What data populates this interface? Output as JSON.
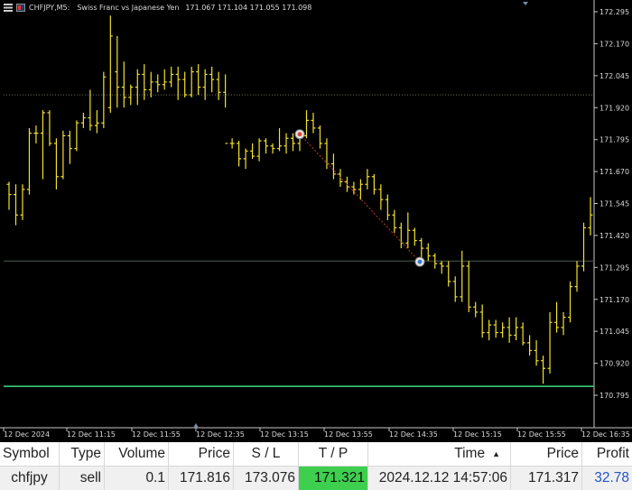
{
  "chart_header": {
    "symbol_tf": "CHFJPY,M5:",
    "description": "Swiss Franc vs Japanese Yen",
    "ohlc": "171.067 171.104 171.055 171.098"
  },
  "colors": {
    "background": "#000000",
    "bar": "#f2e22a",
    "grid_level": "#2e3a2e",
    "tp_line": "#3ddc84",
    "trade_line": "#c0392b",
    "profit_text": "#2255c8",
    "tp_cell": "#3ecf4f"
  },
  "chart_data": {
    "type": "ohlc_bar",
    "symbol": "CHFJPY",
    "timeframe": "M5",
    "y_ticks": [
      "172.295",
      "172.170",
      "172.045",
      "171.920",
      "171.795",
      "171.670",
      "171.545",
      "171.420",
      "171.295",
      "171.170",
      "171.045",
      "170.920",
      "170.795"
    ],
    "ylim": [
      170.72,
      172.33
    ],
    "x_ticks": [
      "12 Dec 2024",
      "12 Dec 11:15",
      "12 Dec 11:55",
      "12 Dec 12:35",
      "12 Dec 13:15",
      "12 Dec 13:55",
      "12 Dec 14:35",
      "12 Dec 15:15",
      "12 Dec 15:55",
      "12 Dec 16:35"
    ],
    "levels": {
      "stop_loss": 173.076,
      "take_profit": 171.321,
      "entry": 171.816,
      "close": 171.317,
      "dotted_level": 171.97,
      "current": 171.32,
      "tp_visual": 170.83
    },
    "bars": [
      [
        171.62,
        171.63,
        171.52,
        171.58
      ],
      [
        171.58,
        171.62,
        171.46,
        171.5
      ],
      [
        171.5,
        171.62,
        171.48,
        171.6
      ],
      [
        171.6,
        171.84,
        171.58,
        171.82
      ],
      [
        171.82,
        171.85,
        171.78,
        171.82
      ],
      [
        171.82,
        171.91,
        171.64,
        171.9
      ],
      [
        171.9,
        171.91,
        171.77,
        171.78
      ],
      [
        171.78,
        171.8,
        171.6,
        171.65
      ],
      [
        171.65,
        171.83,
        171.64,
        171.81
      ],
      [
        171.81,
        171.83,
        171.7,
        171.76
      ],
      [
        171.76,
        171.87,
        171.75,
        171.86
      ],
      [
        171.86,
        171.9,
        171.84,
        171.88
      ],
      [
        171.88,
        171.99,
        171.83,
        171.85
      ],
      [
        171.85,
        171.91,
        171.82,
        171.86
      ],
      [
        171.86,
        172.06,
        171.84,
        172.04
      ],
      [
        171.92,
        172.28,
        171.9,
        172.2
      ],
      [
        172.06,
        172.2,
        171.92,
        172.0
      ],
      [
        172.0,
        172.1,
        171.92,
        171.96
      ],
      [
        171.96,
        172.01,
        171.93,
        172.0
      ],
      [
        172.0,
        172.07,
        171.93,
        172.05
      ],
      [
        172.05,
        172.09,
        171.95,
        171.99
      ],
      [
        171.99,
        172.06,
        171.96,
        172.02
      ],
      [
        172.02,
        172.05,
        171.98,
        172.01
      ],
      [
        172.01,
        172.07,
        171.99,
        172.02
      ],
      [
        172.02,
        172.08,
        172.0,
        172.05
      ],
      [
        172.05,
        172.08,
        171.95,
        172.03
      ],
      [
        172.03,
        172.06,
        171.96,
        171.97
      ],
      [
        171.97,
        172.08,
        171.96,
        172.06
      ],
      [
        172.06,
        172.09,
        171.97,
        172.0
      ],
      [
        172.0,
        172.07,
        171.95,
        172.05
      ],
      [
        172.05,
        172.08,
        171.98,
        172.03
      ],
      [
        172.03,
        172.06,
        171.95,
        171.98
      ],
      [
        171.98,
        172.05,
        171.92,
        171.78
      ],
      [
        171.78,
        171.8,
        171.76,
        171.78
      ],
      [
        171.78,
        171.79,
        171.69,
        171.72
      ],
      [
        171.72,
        171.76,
        171.68,
        171.75
      ],
      [
        171.75,
        171.78,
        171.72,
        171.73
      ],
      [
        171.73,
        171.8,
        171.71,
        171.79
      ],
      [
        171.79,
        171.8,
        171.74,
        171.77
      ],
      [
        171.77,
        171.78,
        171.74,
        171.76
      ],
      [
        171.76,
        171.84,
        171.75,
        171.77
      ],
      [
        171.77,
        171.82,
        171.74,
        171.8
      ],
      [
        171.8,
        171.82,
        171.75,
        171.78
      ],
      [
        171.78,
        171.82,
        171.75,
        171.81
      ],
      [
        171.81,
        171.91,
        171.8,
        171.87
      ],
      [
        171.87,
        171.9,
        171.82,
        171.84
      ],
      [
        171.84,
        171.85,
        171.76,
        171.78
      ],
      [
        171.78,
        171.8,
        171.68,
        171.7
      ],
      [
        171.7,
        171.74,
        171.64,
        171.66
      ],
      [
        171.66,
        171.68,
        171.61,
        171.63
      ],
      [
        171.63,
        171.65,
        171.59,
        171.61
      ],
      [
        171.61,
        171.63,
        171.58,
        171.6
      ],
      [
        171.6,
        171.64,
        171.56,
        171.62
      ],
      [
        171.62,
        171.68,
        171.6,
        171.65
      ],
      [
        171.65,
        171.66,
        171.58,
        171.6
      ],
      [
        171.6,
        171.62,
        171.52,
        171.56
      ],
      [
        171.56,
        171.58,
        171.48,
        171.5
      ],
      [
        171.5,
        171.52,
        171.43,
        171.45
      ],
      [
        171.45,
        171.47,
        171.37,
        171.39
      ],
      [
        171.39,
        171.51,
        171.37,
        171.44
      ],
      [
        171.44,
        171.45,
        171.38,
        171.4
      ],
      [
        171.4,
        171.41,
        171.33,
        171.37
      ],
      [
        171.37,
        171.39,
        171.32,
        171.34
      ],
      [
        171.34,
        171.35,
        171.29,
        171.31
      ],
      [
        171.31,
        171.32,
        171.27,
        171.3
      ],
      [
        171.3,
        171.32,
        171.22,
        171.24
      ],
      [
        171.24,
        171.26,
        171.16,
        171.18
      ],
      [
        171.18,
        171.36,
        171.16,
        171.3
      ],
      [
        171.3,
        171.32,
        171.12,
        171.14
      ],
      [
        171.14,
        171.16,
        171.1,
        171.12
      ],
      [
        171.12,
        171.15,
        171.02,
        171.04
      ],
      [
        171.04,
        171.09,
        171.01,
        171.07
      ],
      [
        171.07,
        171.09,
        171.02,
        171.04
      ],
      [
        171.04,
        171.08,
        171.02,
        171.06
      ],
      [
        171.06,
        171.1,
        171.0,
        171.03
      ],
      [
        171.03,
        171.1,
        171.01,
        171.06
      ],
      [
        171.06,
        171.08,
        170.99,
        171.0
      ],
      [
        171.0,
        171.03,
        170.95,
        170.97
      ],
      [
        170.97,
        171.01,
        170.91,
        170.93
      ],
      [
        170.93,
        170.95,
        170.84,
        170.9
      ],
      [
        170.9,
        171.12,
        170.88,
        171.08
      ],
      [
        171.08,
        171.16,
        171.04,
        171.06
      ],
      [
        171.06,
        171.12,
        171.03,
        171.1
      ],
      [
        171.1,
        171.24,
        171.08,
        171.22
      ],
      [
        171.22,
        171.32,
        171.2,
        171.3
      ],
      [
        171.3,
        171.47,
        171.28,
        171.45
      ],
      [
        171.45,
        171.57,
        171.42,
        171.5
      ]
    ]
  },
  "trade_markers": {
    "entry_price": 171.816,
    "close_price": 171.317
  },
  "table": {
    "headers": [
      "Symbol",
      "Type",
      "Volume",
      "Price",
      "S / L",
      "T / P",
      "Time",
      "Price",
      "Profit"
    ],
    "sort_indicator": "▲",
    "row": [
      "chfjpy",
      "sell",
      "0.1",
      "171.816",
      "173.076",
      "171.321",
      "2024.12.12 14:57:06",
      "171.317",
      "32.78"
    ]
  }
}
